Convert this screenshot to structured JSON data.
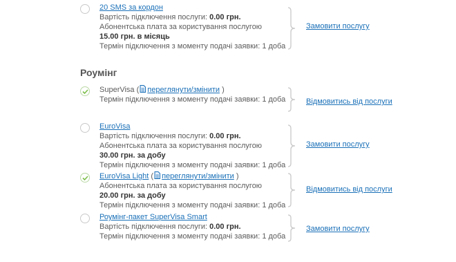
{
  "labels": {
    "cost": "Вартість підключення послуги:",
    "fee": "Абонентська плата за користування послугою",
    "term": "Термін підключення з моменту подачі заявки:"
  },
  "services_top": [
    {
      "name": "20 SMS за кордон",
      "active": false,
      "cost": "0.00 грн.",
      "fee": "15.00 грн. в місяць",
      "term": "1 доба",
      "action": "Замовити послугу"
    }
  ],
  "section": {
    "title": "Роумінг"
  },
  "services": [
    {
      "name": "SuperVisa",
      "active": true,
      "edit_link": "переглянути/змінити",
      "term": "1 доба",
      "action": "Відмовитись від послуги"
    },
    {
      "name": "EuroVisa",
      "active": false,
      "cost": "0.00 грн.",
      "fee": "30.00 грн. за добу",
      "term": "1 доба",
      "action": "Замовити послугу"
    },
    {
      "name": "EuroVisa Light",
      "active": true,
      "edit_link": "переглянути/змінити",
      "fee": "20.00 грн. за добу",
      "term": "1 доба",
      "action": "Відмовитись від послуги"
    },
    {
      "name": "Роумінг-пакет SuperVisa Smart",
      "active": false,
      "cost": "0.00 грн.",
      "term": "1 доба",
      "action": "Замовити послугу"
    }
  ],
  "colors": {
    "link": "#1a70b8",
    "text": "#5b5b5b",
    "check": "#7cbf4a",
    "brace": "#c8c8c8"
  }
}
